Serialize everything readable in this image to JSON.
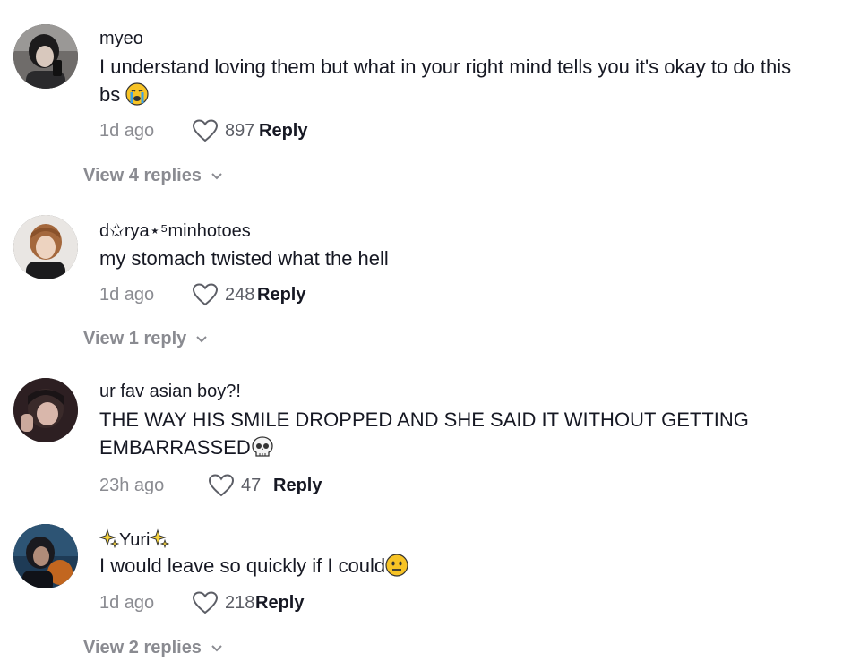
{
  "comments": [
    {
      "username": "myeo",
      "text": "I understand loving them but what in your right mind tells you it's okay to do this bs",
      "emoji": "crying-face",
      "time": "1d ago",
      "likes": "897",
      "reply_label": "Reply",
      "view_replies": "View 4 replies"
    },
    {
      "username": "d✩rya⋆⁵minhotoes",
      "text": "my stomach twisted what the hell",
      "time": "1d ago",
      "likes": "248",
      "reply_label": "Reply",
      "view_replies": "View 1 reply"
    },
    {
      "username": "ur fav asian boy?!",
      "text": "THE WAY HIS SMILE DROPPED AND SHE SAID IT WITHOUT GETTING EMBARRASSED",
      "emoji": "skull",
      "time": "23h ago",
      "likes": "47",
      "reply_label": "Reply"
    },
    {
      "username": "Yuri",
      "username_decoration": "sparkles",
      "text": "I would leave so quickly if I could",
      "emoji": "neutral-face",
      "time": "1d ago",
      "likes": "218",
      "reply_label": "Reply",
      "view_replies": "View 2 replies"
    }
  ]
}
